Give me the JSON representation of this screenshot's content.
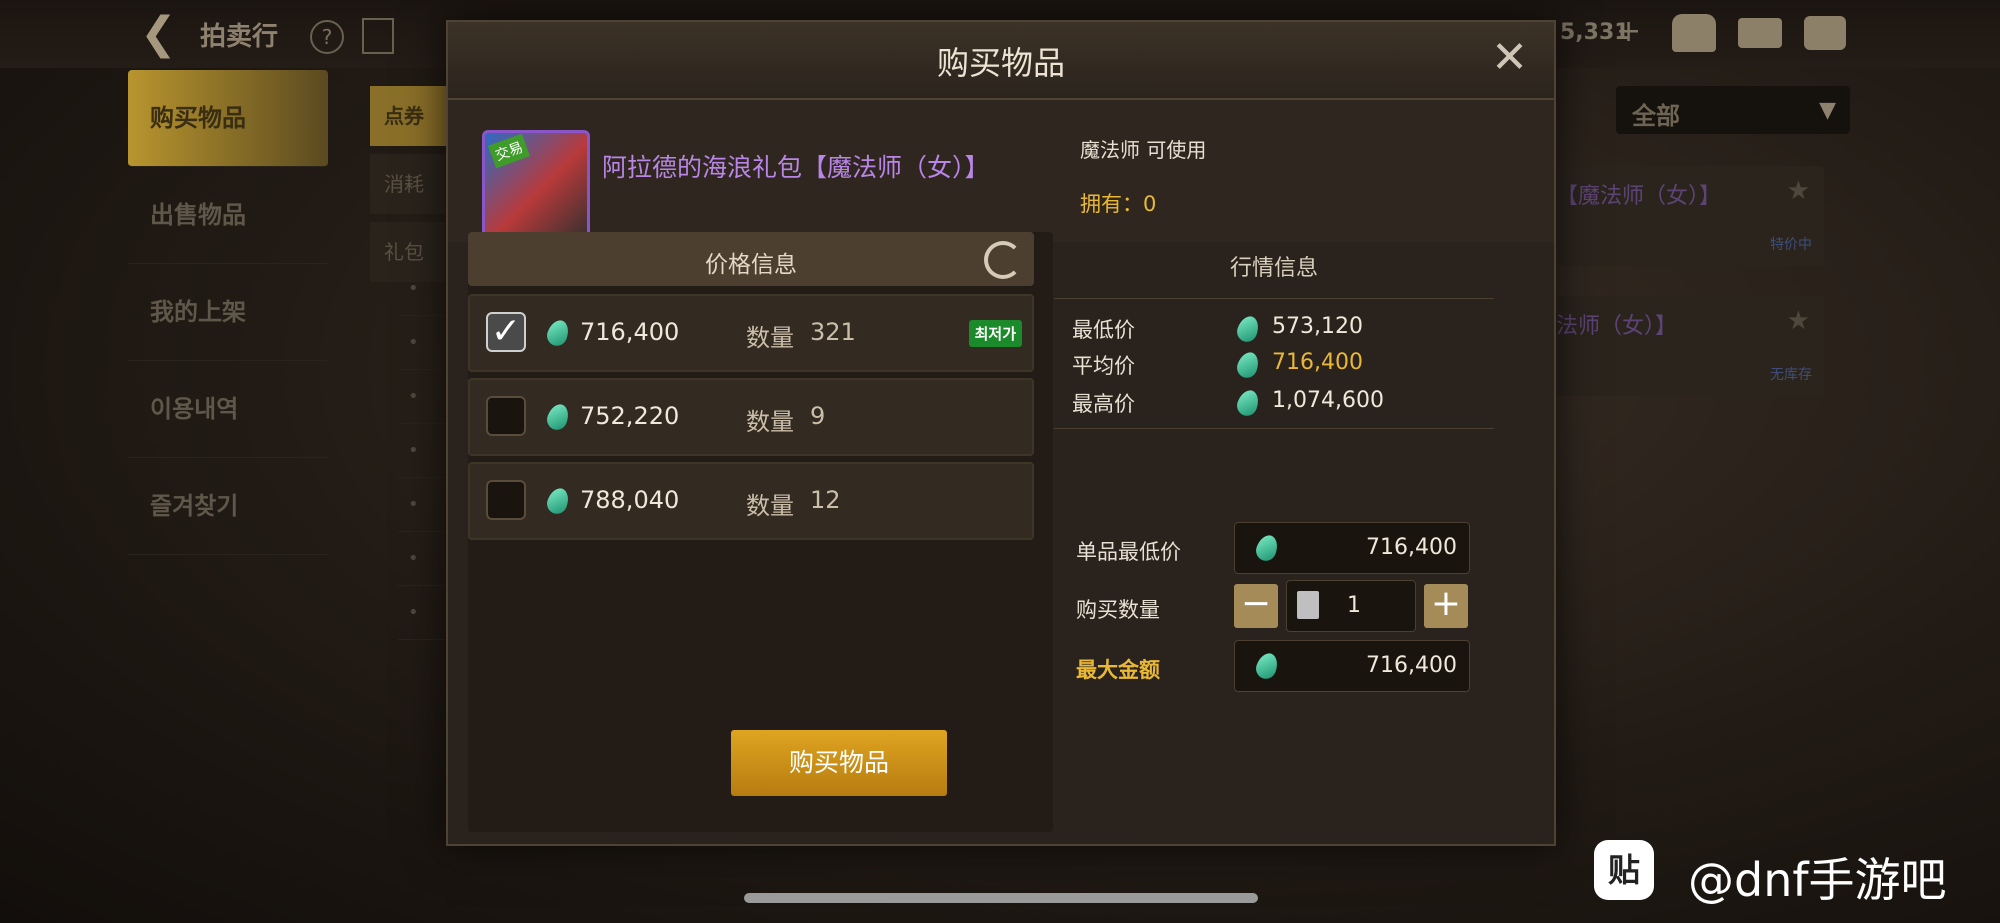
{
  "topbar": {
    "title": "拍卖行",
    "help": "?",
    "currency_partial": "5,331"
  },
  "side_nav": [
    "购买物品",
    "出售物品",
    "我的上架",
    "이용내역",
    "즐겨찾기"
  ],
  "bg_tabs": [
    "点券",
    "消耗",
    "礼包"
  ],
  "bg_filter": {
    "label": "全部"
  },
  "bg_cards": [
    {
      "title": "【魔法师（女）】",
      "tag": "特价中"
    },
    {
      "title": "法师（女）】",
      "tag": "无库存"
    }
  ],
  "modal": {
    "title": "购买物品",
    "item": {
      "icon_badge": "交易",
      "name": "阿拉德的海浪礼包【魔法师（女）】",
      "usable_note": "魔法师 可使用",
      "owned": "拥有：0"
    },
    "price_panel": {
      "header": "价格信息",
      "qty_label": "数量",
      "rows": [
        {
          "price": "716,400",
          "qty": "321",
          "checked": true,
          "badge": "최저가"
        },
        {
          "price": "752,220",
          "qty": "9",
          "checked": false,
          "badge": ""
        },
        {
          "price": "788,040",
          "qty": "12",
          "checked": false,
          "badge": ""
        }
      ]
    },
    "market": {
      "title": "行情信息",
      "rows": [
        {
          "label": "最低价",
          "value": "573,120"
        },
        {
          "label": "平均价",
          "value": "716,400"
        },
        {
          "label": "最高价",
          "value": "1,074,600"
        }
      ]
    },
    "form": {
      "unit_min_label": "单品最低价",
      "unit_min_value": "716,400",
      "qty_label": "购买数量",
      "qty_value": "1",
      "minus": "−",
      "plus": "+",
      "max_label": "最大金额",
      "max_value": "716,400"
    },
    "buy_button": "购买物品",
    "close": "✕"
  },
  "watermark": {
    "icon": "贴",
    "text": "@dnf手游吧"
  },
  "colors": {
    "accent_gold": "#e9b836",
    "purple_item": "#b985e6",
    "gem": "#2fc59a",
    "badge_green": "#1b8a2a"
  }
}
